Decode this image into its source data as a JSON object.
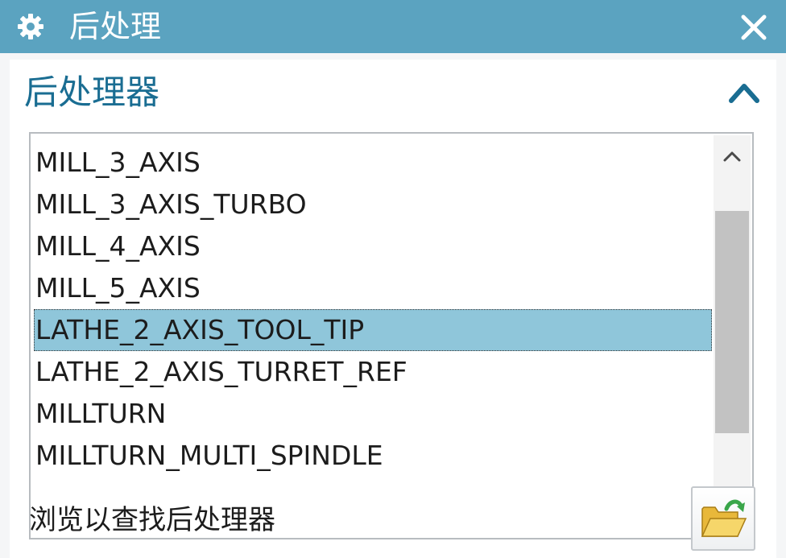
{
  "window": {
    "title": "后处理",
    "title_icon": "gear-icon",
    "close_icon": "close-icon"
  },
  "section": {
    "title": "后处理器",
    "collapse_icon": "chevron-up-icon"
  },
  "postprocessor_list": {
    "items": [
      "MILL_3_AXIS",
      "MILL_3_AXIS_TURBO",
      "MILL_4_AXIS",
      "MILL_5_AXIS",
      "LATHE_2_AXIS_TOOL_TIP",
      "LATHE_2_AXIS_TURRET_REF",
      "MILLTURN",
      "MILLTURN_MULTI_SPINDLE"
    ],
    "selected": "LATHE_2_AXIS_TOOL_TIP",
    "scroll_up_icon": "chevron-up-icon",
    "scroll_down_icon": "chevron-down-icon"
  },
  "browse": {
    "label": "浏览以查找后处理器",
    "icon": "open-folder-icon"
  },
  "colors": {
    "titlebar": "#5ba3c0",
    "section_title": "#1a6d92",
    "selection": "#8fc6da"
  }
}
